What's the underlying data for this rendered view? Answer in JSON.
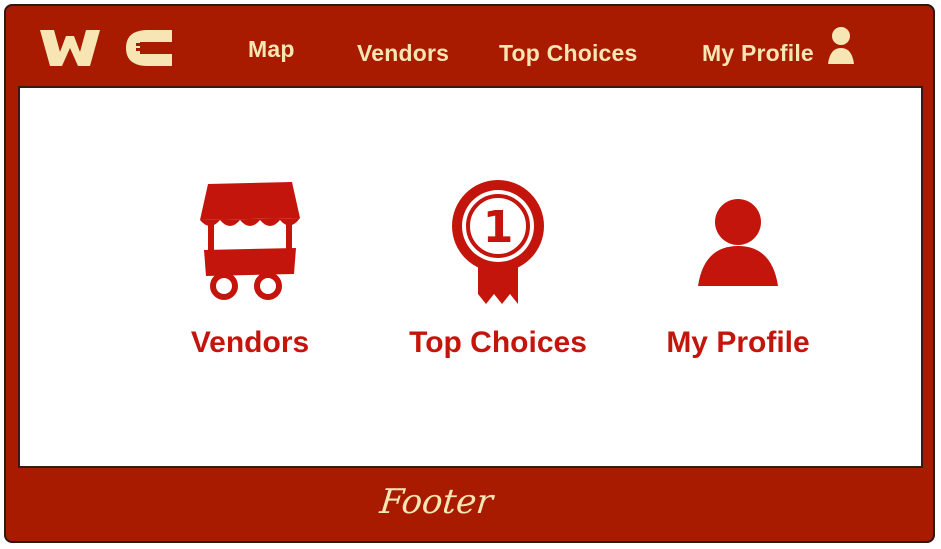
{
  "header": {
    "logo_text": "WC",
    "nav": {
      "map": "Map",
      "vendors": "Vendors",
      "top_choices": "Top Choices",
      "my_profile": "My Profile"
    },
    "profile_icon": "user-icon"
  },
  "main": {
    "tiles": [
      {
        "label": "Vendors",
        "icon": "vendor-cart-icon"
      },
      {
        "label": "Top Choices",
        "icon": "award-ribbon-icon",
        "badge_number": "1"
      },
      {
        "label": "My Profile",
        "icon": "user-icon"
      }
    ]
  },
  "footer": {
    "text": "Footer"
  },
  "colors": {
    "frame": "#a81b00",
    "nav_text": "#f7e6b4",
    "accent": "#c4150c",
    "content_bg": "#ffffff"
  }
}
